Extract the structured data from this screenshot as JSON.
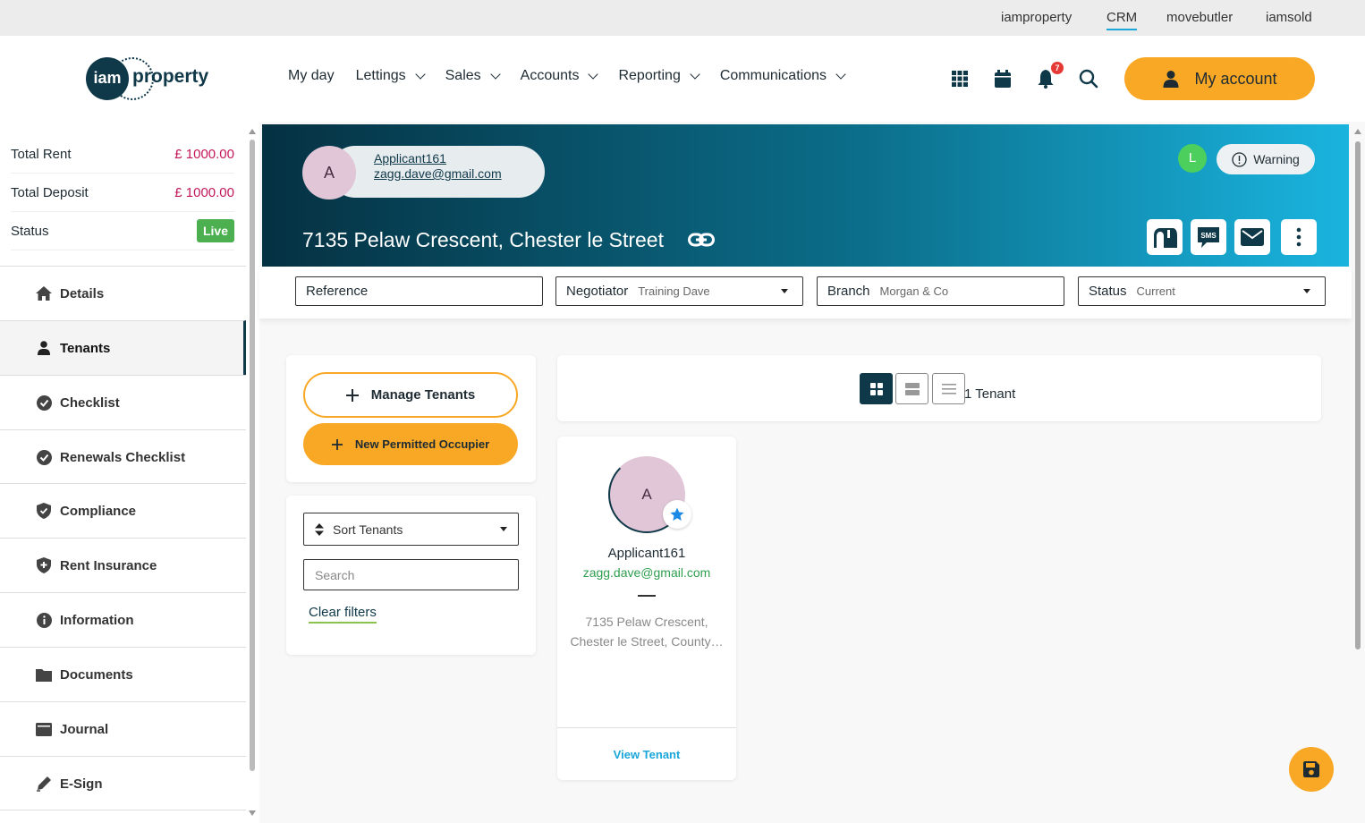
{
  "top_links": [
    {
      "label": "iamproperty"
    },
    {
      "label": "CRM",
      "active": true
    },
    {
      "label": "movebutler"
    },
    {
      "label": "iamsold"
    }
  ],
  "logo": {
    "circle_text": "iam",
    "text": "property"
  },
  "nav": [
    {
      "label": "My day"
    },
    {
      "label": "Lettings"
    },
    {
      "label": "Sales"
    },
    {
      "label": "Accounts"
    },
    {
      "label": "Reporting"
    },
    {
      "label": "Communications"
    }
  ],
  "header_icons": {
    "grid": "apps-grid-icon",
    "calendar": "calendar-icon",
    "bell": "bell-icon",
    "notification_count": "7",
    "search": "search-icon"
  },
  "account": {
    "label": "My account"
  },
  "summary": [
    {
      "label": "Total Rent",
      "value": "£ 1000.00"
    },
    {
      "label": "Total Deposit",
      "value": "£ 1000.00"
    },
    {
      "label": "Status",
      "value": "Live"
    }
  ],
  "sidebar_items": [
    {
      "label": "Details",
      "icon": "home-icon"
    },
    {
      "label": "Tenants",
      "icon": "person-icon",
      "active": true
    },
    {
      "label": "Checklist",
      "icon": "check-circle-icon"
    },
    {
      "label": "Renewals Checklist",
      "icon": "check-circle-icon"
    },
    {
      "label": "Compliance",
      "icon": "shield-check-icon"
    },
    {
      "label": "Rent Insurance",
      "icon": "shield-plus-icon"
    },
    {
      "label": "Information",
      "icon": "info-icon"
    },
    {
      "label": "Documents",
      "icon": "folder-icon"
    },
    {
      "label": "Journal",
      "icon": "journal-icon"
    },
    {
      "label": "E-Sign",
      "icon": "pen-icon"
    }
  ],
  "banner": {
    "applicant_initial": "A",
    "applicant_name": "Applicant161",
    "applicant_email": "zagg.dave@gmail.com",
    "title": "7135 Pelaw Crescent, Chester le Street",
    "user_initial": "L",
    "warning_label": "Warning",
    "gradient": [
      "#053142",
      "#1ab4df"
    ],
    "sms_label": "SMS"
  },
  "filters": {
    "reference": {
      "label": "Reference"
    },
    "negotiator": {
      "label": "Negotiator",
      "value": "Training Dave"
    },
    "branch": {
      "label": "Branch",
      "value": "Morgan & Co"
    },
    "status": {
      "label": "Status",
      "value": "Current"
    }
  },
  "actions": {
    "manage_tenants": "Manage Tenants",
    "new_occupier": "New Permitted Occupier"
  },
  "sort": {
    "label": "Sort Tenants"
  },
  "search": {
    "placeholder": "Search"
  },
  "clear_filters": "Clear filters",
  "tenant_count": "1 Tenant",
  "tenant_card": {
    "initial": "A",
    "name": "Applicant161",
    "email": "zagg.dave@gmail.com",
    "address": "7135 Pelaw Crescent, Chester le Street, County…",
    "view_label": "View Tenant"
  },
  "colors": {
    "accent": "#f9a825",
    "navy": "#0f3848",
    "live": "#4caf50",
    "money": "#c2185b"
  }
}
